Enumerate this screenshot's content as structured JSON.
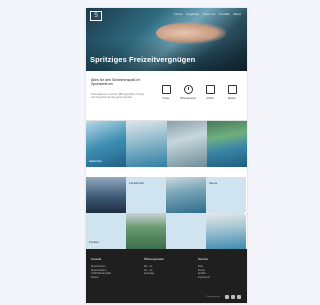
{
  "header": {
    "logo_text": "S",
    "nav": [
      "Home",
      "Angebote",
      "Über uns",
      "Kontakt",
      "Menü"
    ],
    "hero_title": "Spritziges Freizeitvergnügen"
  },
  "info": {
    "heading": "Alles für den Schwimmspaß im Sportzentrum",
    "text": "Informationen rund um Öffnungszeiten, Preise und Angebote für die ganze Familie.",
    "icons": [
      {
        "name": "euro-icon",
        "label": "Preise"
      },
      {
        "name": "clock-icon",
        "label": "Öffnungszeiten"
      },
      {
        "name": "bus-icon",
        "label": "Anfahrt"
      },
      {
        "name": "pool-icon",
        "label": "Becken"
      }
    ]
  },
  "strip": [
    {
      "caption": "Hallenbad"
    },
    {
      "caption": ""
    },
    {
      "caption": ""
    },
    {
      "caption": ""
    }
  ],
  "grid": {
    "cells": [
      {
        "title": ""
      },
      {
        "title": "Freibad Zell"
      },
      {
        "title": ""
      },
      {
        "title": "Sauna"
      },
      {
        "title": "Freibad"
      },
      {
        "title": ""
      },
      {
        "title": ""
      },
      {
        "title": ""
      }
    ]
  },
  "footer": {
    "columns": [
      {
        "heading": "Kontakt",
        "items": [
          "Sportzentrum",
          "Musterstraße 1",
          "12345 Musterstadt",
          "Telefon"
        ]
      },
      {
        "heading": "Öffnungszeiten",
        "items": [
          "Mo – Fr",
          "Sa – So",
          "Feiertage"
        ]
      },
      {
        "heading": "Service",
        "items": [
          "FAQ",
          "Preise",
          "Anfahrt",
          "Impressum"
        ]
      }
    ],
    "copyright": "© Sportzentrum"
  }
}
